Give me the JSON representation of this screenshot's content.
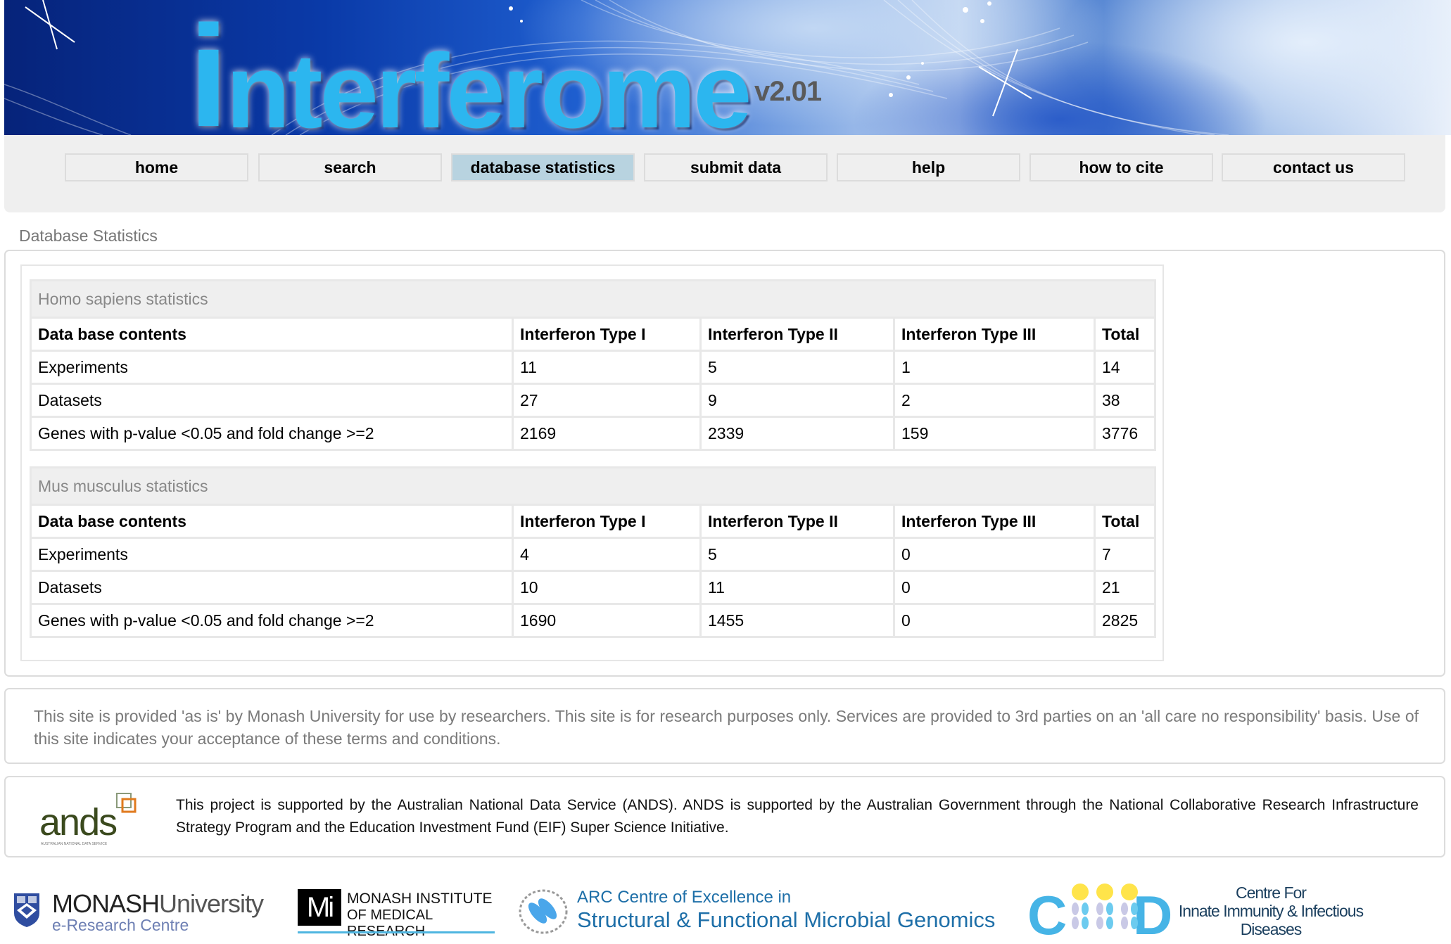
{
  "header": {
    "logo_first_letter": "i",
    "logo_rest": "nterferome",
    "version": "v2.01"
  },
  "nav": {
    "items": [
      {
        "label": "home",
        "active": false
      },
      {
        "label": "search",
        "active": false
      },
      {
        "label": "database statistics",
        "active": true
      },
      {
        "label": "submit data",
        "active": false
      },
      {
        "label": "help",
        "active": false
      },
      {
        "label": "how to cite",
        "active": false
      },
      {
        "label": "contact us",
        "active": false
      }
    ],
    "active_color": "#b8d3e0"
  },
  "page_title": "Database Statistics",
  "tables": [
    {
      "title": "Homo sapiens statistics",
      "columns": [
        "Data base contents",
        "Interferon Type I",
        "Interferon Type II",
        "Interferon Type III",
        "Total"
      ],
      "rows": [
        [
          "Experiments",
          "11",
          "5",
          "1",
          "14"
        ],
        [
          "Datasets",
          "27",
          "9",
          "2",
          "38"
        ],
        [
          "Genes with p-value <0.05 and fold change >=2",
          "2169",
          "2339",
          "159",
          "3776"
        ]
      ]
    },
    {
      "title": "Mus musculus statistics",
      "columns": [
        "Data base contents",
        "Interferon Type I",
        "Interferon Type II",
        "Interferon Type III",
        "Total"
      ],
      "rows": [
        [
          "Experiments",
          "4",
          "5",
          "0",
          "7"
        ],
        [
          "Datasets",
          "10",
          "11",
          "0",
          "21"
        ],
        [
          "Genes with p-value <0.05 and fold change >=2",
          "1690",
          "1455",
          "0",
          "2825"
        ]
      ]
    }
  ],
  "disclaimer": "This site is provided 'as is' by Monash University for use by researchers. This site is for research purposes only. Services are provided to 3rd parties on an 'all care no responsibility' basis. Use of this site indicates your acceptance of these terms and conditions.",
  "ands": {
    "logo_text": "ands",
    "logo_subtext": "AUSTRALIAN NATIONAL DATA SERVICE",
    "text": "This project is supported by the Australian National Data Service (ANDS). ANDS is supported by the Australian Government through the National Collaborative Research Infrastructure Strategy Program and the Education Investment Fund (EIF) Super Science Initiative."
  },
  "partners": {
    "monash": {
      "name_bold": "MONASH",
      "name_rest": "University",
      "sub": "e-Research Centre"
    },
    "mimr": {
      "mark": "Mi",
      "line1": "MONASH INSTITUTE",
      "line2": "OF MEDICAL RESEARCH"
    },
    "arc": {
      "line1": "ARC Centre of Excellence in",
      "line2": "Structural & Functional Microbial Genomics"
    },
    "ciiid": {
      "mark_left": "C",
      "mark_right": "D",
      "line1": "Centre For",
      "line2": "Innate Immunity & Infectious",
      "line3": "Diseases"
    }
  }
}
